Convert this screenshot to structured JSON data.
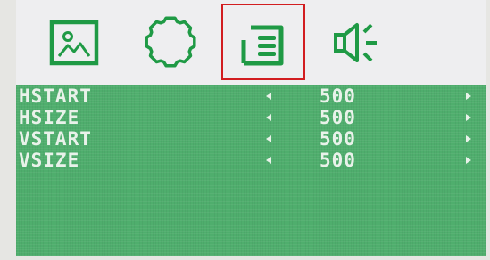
{
  "colors": {
    "accent_green": "#1f9a45",
    "menu_green": "#4fae6d",
    "active_border": "#d21d20",
    "text": "#e9f2ea"
  },
  "tabs": [
    {
      "name": "picture",
      "icon": "picture-icon",
      "active": false
    },
    {
      "name": "settings",
      "icon": "gear-icon",
      "active": false
    },
    {
      "name": "position",
      "icon": "document-icon",
      "active": true
    },
    {
      "name": "audio",
      "icon": "speaker-icon",
      "active": false
    }
  ],
  "menu": {
    "rows": [
      {
        "label": "HSTART",
        "value": "500"
      },
      {
        "label": "HSIZE",
        "value": "500"
      },
      {
        "label": "VSTART",
        "value": "500"
      },
      {
        "label": "VSIZE",
        "value": "500"
      }
    ]
  }
}
